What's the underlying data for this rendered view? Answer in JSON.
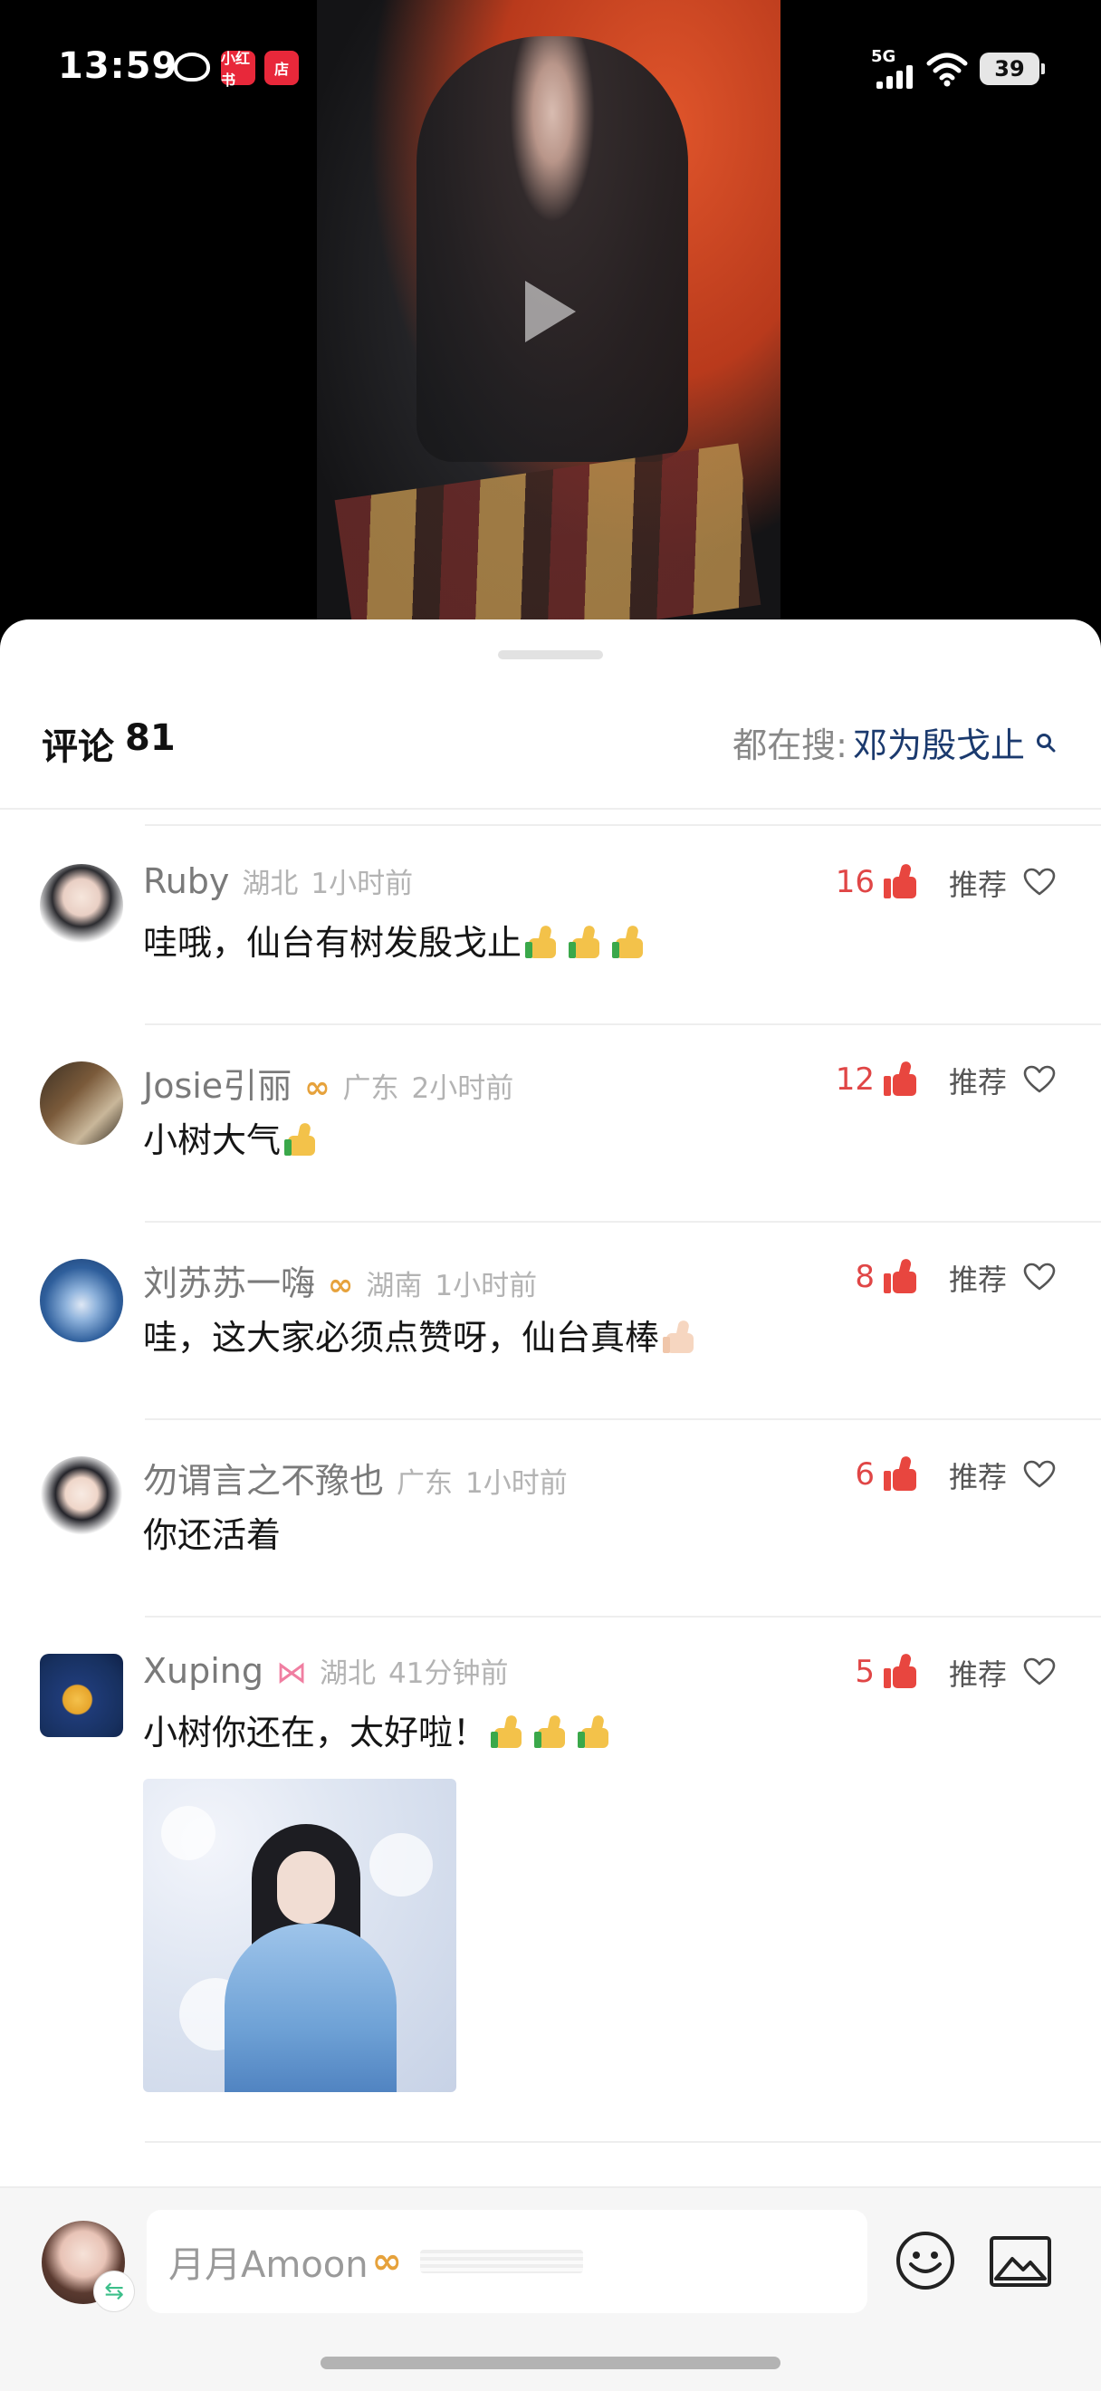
{
  "status_bar": {
    "time": "13:59",
    "app_badges": [
      "小红书",
      "店"
    ],
    "network": "5G",
    "battery": "39"
  },
  "sheet": {
    "title": "评论",
    "count": "81",
    "trending_label": "都在搜:",
    "trending_term": "邓为殷戈止"
  },
  "comments": [
    {
      "name": "Ruby",
      "location": "湖北",
      "time": "1小时前",
      "text": "哇哦，仙台有树发殷戈止",
      "emoji": "thumbs-up x3",
      "likes": "16",
      "recommend": "推荐"
    },
    {
      "name": "Josie引丽",
      "location": "广东",
      "time": "2小时前",
      "text": "小树大气",
      "emoji": "thumbs-up x1",
      "likes": "12",
      "recommend": "推荐"
    },
    {
      "name": "刘苏苏一嗨",
      "location": "湖南",
      "time": "1小时前",
      "text": "哇，这大家必须点赞呀，仙台真棒",
      "emoji": "thumbs-up light x1",
      "likes": "8",
      "recommend": "推荐"
    },
    {
      "name": "勿谓言之不豫也",
      "location": "广东",
      "time": "1小时前",
      "text": "你还活着",
      "emoji": "",
      "likes": "6",
      "recommend": "推荐"
    },
    {
      "name": "Xuping",
      "location": "湖北",
      "time": "41分钟前",
      "text": "小树你还在，太好啦！",
      "emoji": "thumbs-up x3",
      "likes": "5",
      "recommend": "推荐"
    }
  ],
  "input": {
    "user_name": "月月Amoon"
  },
  "colors": {
    "like_red": "#e04646",
    "vip_gold": "#e6a23c",
    "trending_blue": "#1b3a6e"
  },
  "icons": [
    "play-icon",
    "search-icon",
    "like-icon",
    "heart-icon",
    "vip-icon",
    "bow-icon",
    "emoji-icon",
    "image-icon",
    "switch-account-icon"
  ]
}
